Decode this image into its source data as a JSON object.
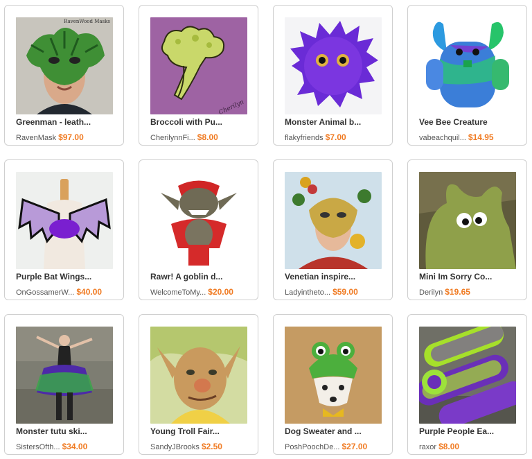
{
  "listings": [
    {
      "title": "Greenman - leath...",
      "seller": "RavenMask",
      "price": "$97.00",
      "image_icon": "greenman-mask-photo",
      "watermark": "RavenWood Masks"
    },
    {
      "title": "Broccoli with Pu...",
      "seller": "CherilynnFi...",
      "price": "$8.00",
      "image_icon": "broccoli-painting",
      "signature": "Cherilyn"
    },
    {
      "title": "Monster Animal b...",
      "seller": "flakyfriends",
      "price": "$7.00",
      "image_icon": "purple-fuzzy-monster-photo"
    },
    {
      "title": "Vee Bee Creature",
      "seller": "vabeachquil...",
      "price": "$14.95",
      "image_icon": "tiedye-plush-creature-photo"
    },
    {
      "title": "Purple Bat Wings...",
      "seller": "OnGossamerW...",
      "price": "$40.00",
      "image_icon": "bat-wings-photo"
    },
    {
      "title": "Rawr! A goblin d...",
      "seller": "WelcomeToMy...",
      "price": "$20.00",
      "image_icon": "goblin-doll-photo"
    },
    {
      "title": "Venetian inspire...",
      "seller": "Ladyintheto...",
      "price": "$59.00",
      "image_icon": "venetian-mask-photo"
    },
    {
      "title": "Mini Im Sorry Co...",
      "seller": "Derilyn",
      "price": "$19.65",
      "image_icon": "green-plush-monster-photo"
    },
    {
      "title": "Monster tutu ski...",
      "seller": "SistersOfth...",
      "price": "$34.00",
      "image_icon": "tutu-skirt-photo"
    },
    {
      "title": "Young Troll Fair...",
      "seller": "SandyJBrooks",
      "price": "$2.50",
      "image_icon": "troll-painting"
    },
    {
      "title": "Dog Sweater and ...",
      "seller": "PoshPoochDe...",
      "price": "$27.00",
      "image_icon": "dog-frog-hat-photo"
    },
    {
      "title": "Purple People Ea...",
      "seller": "raxor",
      "price": "$8.00",
      "image_icon": "felted-rolls-photo"
    }
  ],
  "colors": {
    "price": "#f07b23",
    "title": "#333333",
    "seller": "#555555",
    "border": "#cfcfcf"
  }
}
